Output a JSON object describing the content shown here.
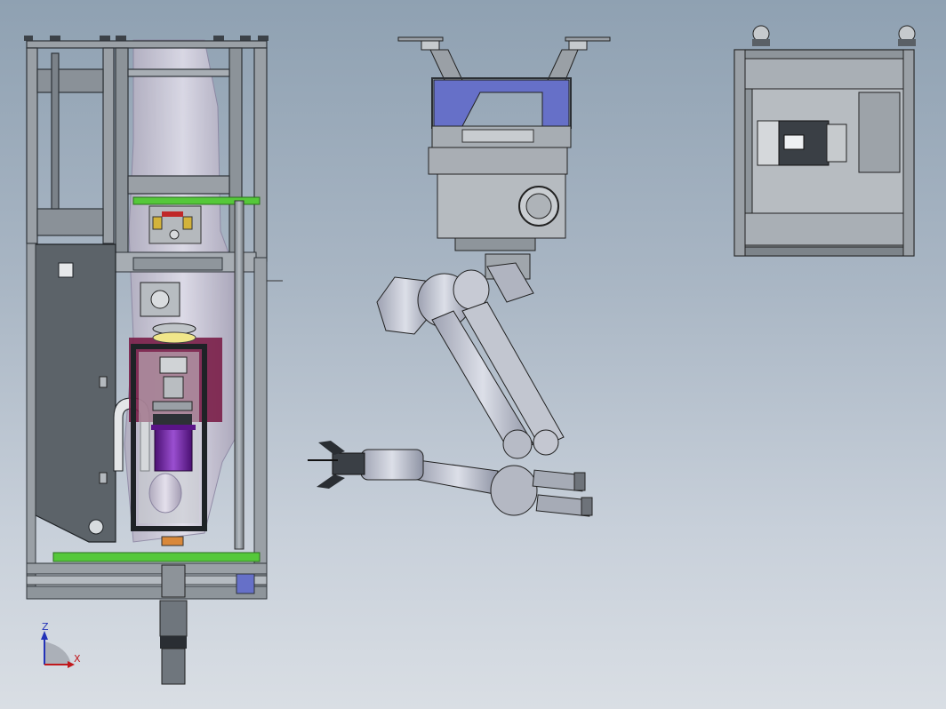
{
  "window": {
    "kind": "cad-3d-viewport",
    "background": {
      "top": "#8fa1b2",
      "bottom": "#d9dee4"
    }
  },
  "views": [
    {
      "id": "view-cabinet",
      "description_name": "cabinet-frame-assembly"
    },
    {
      "id": "view-robot-arm",
      "description_name": "robot-arm-assembly"
    },
    {
      "id": "view-motor-box",
      "description_name": "motor-box-assembly"
    }
  ],
  "triad": {
    "z_label": "Z",
    "x_label": "X",
    "colors": {
      "z": "#2232b8",
      "x": "#c0181c"
    }
  },
  "palette": {
    "frame": "#8f979f",
    "frame_dark": "#3c4248",
    "panel": "#6f767d",
    "green_plate": "#55c83a",
    "purple_motor": "#6a1d9c",
    "violet_plate": "#6670c8",
    "arm_light": "#c9ccd6",
    "arm_mid": "#a7abb8",
    "maroon": "#7a1e48"
  }
}
